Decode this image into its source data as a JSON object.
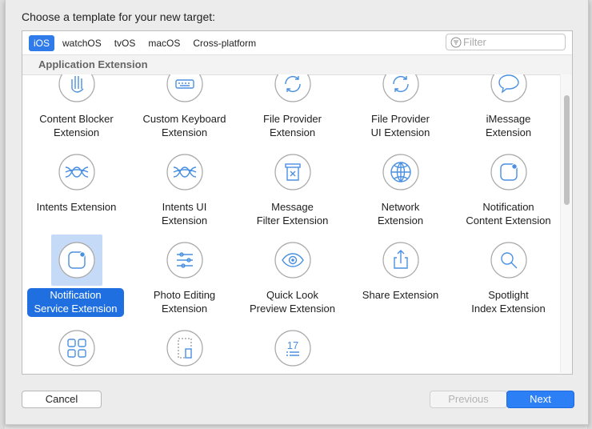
{
  "dialog": {
    "title": "Choose a template for your new target:",
    "platform_tabs": [
      {
        "label": "iOS",
        "active": true
      },
      {
        "label": "watchOS",
        "active": false
      },
      {
        "label": "tvOS",
        "active": false
      },
      {
        "label": "macOS",
        "active": false
      },
      {
        "label": "Cross-platform",
        "active": false
      }
    ],
    "filter": {
      "placeholder": "Filter",
      "value": ""
    },
    "section": "Application Extension",
    "templates": [
      {
        "label": [
          "Content Blocker",
          "Extension"
        ],
        "icon": "hand-icon"
      },
      {
        "label": [
          "Custom Keyboard",
          "Extension"
        ],
        "icon": "keyboard-icon"
      },
      {
        "label": [
          "File Provider",
          "Extension"
        ],
        "icon": "refresh-icon"
      },
      {
        "label": [
          "File Provider",
          "UI Extension"
        ],
        "icon": "refresh-icon"
      },
      {
        "label": [
          "iMessage",
          "Extension"
        ],
        "icon": "message-bubble-icon"
      },
      {
        "label": [
          "Intents Extension"
        ],
        "icon": "intents-icon"
      },
      {
        "label": [
          "Intents UI",
          "Extension"
        ],
        "icon": "intents-icon"
      },
      {
        "label": [
          "Message",
          "Filter Extension"
        ],
        "icon": "filter-bin-icon"
      },
      {
        "label": [
          "Network",
          "Extension"
        ],
        "icon": "globe-icon"
      },
      {
        "label": [
          "Notification",
          "Content Extension"
        ],
        "icon": "notification-icon"
      },
      {
        "label": [
          "Notification",
          "Service Extension"
        ],
        "icon": "notification-icon",
        "selected": true
      },
      {
        "label": [
          "Photo Editing",
          "Extension"
        ],
        "icon": "sliders-icon"
      },
      {
        "label": [
          "Quick Look",
          "Preview Extension"
        ],
        "icon": "eye-icon"
      },
      {
        "label": [
          "Share Extension"
        ],
        "icon": "share-icon"
      },
      {
        "label": [
          "Spotlight",
          "Index Extension"
        ],
        "icon": "magnifier-icon"
      },
      {
        "label": [],
        "icon": "app-grid-icon"
      },
      {
        "label": [],
        "icon": "document-frame-icon"
      },
      {
        "label": [],
        "icon": "calendar-icon",
        "icon_text": "17"
      }
    ],
    "buttons": {
      "cancel": "Cancel",
      "previous": "Previous",
      "next": "Next"
    },
    "colors": {
      "accent": "#2f7bea",
      "selection": "#1f6fe0",
      "icon_stroke": "#4a90e2"
    }
  }
}
